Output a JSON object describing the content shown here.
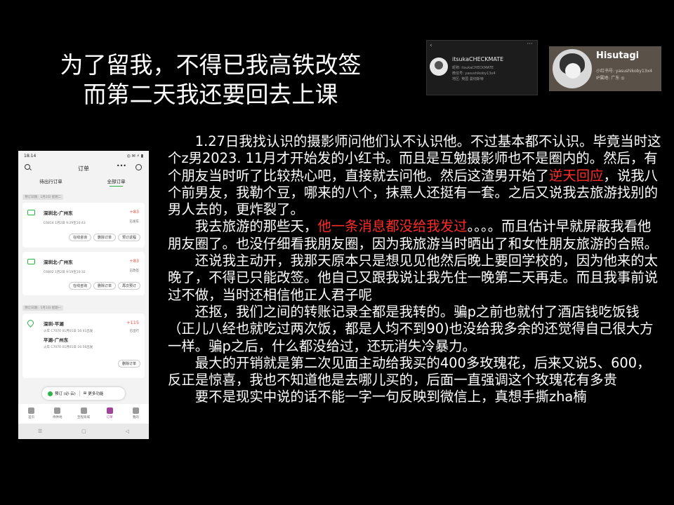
{
  "title": {
    "line1": "为了留我，不得已我高铁改签",
    "line2": "而第二天我还要回去上课"
  },
  "profile1": {
    "name": "itsukaCHECKMATE",
    "meta": [
      "昵称: itsukaCHECKMATE",
      "微信号: yasushikoby13x4",
      "地区: 英国 曼彻斯特"
    ]
  },
  "profile2": {
    "name": "Hisutagi",
    "meta": [
      "小红书号: yasushikoby13x4",
      "IP属地: 广东 ◎"
    ]
  },
  "phone": {
    "time": "18:14",
    "status_icons": "◎ ✉ ⚡ ▮",
    "header_title": "订单",
    "header_more": "•••",
    "tab_pending": "待出行订单",
    "tab_all": "全部订单",
    "sections": [
      "预订日期：1月2日 星期二",
      "预订日期：1月1日 星期一"
    ],
    "orders": [
      {
        "route": "深圳北-广州东",
        "price": "+83",
        "info": "C6814 1月2日 9:29至10:43",
        "state": "已发车",
        "buttons": [
          "在线咨询",
          "删除订单",
          "预订返程"
        ]
      },
      {
        "route": "深圳北-广州东",
        "price": "+83",
        "info": "C6802 1月2日 9:19至10:32",
        "state": "已改签",
        "buttons": [
          "在线咨询",
          "删除订单",
          "再次预订"
        ]
      },
      {
        "route": "深圳-平湖",
        "price": "+115",
        "info": "火车 C7070 01月01日 16:41出发",
        "route2": "平湖-广州东",
        "info2": "火车 C7070 01月01日 16:56出发",
        "state": "已出行",
        "buttons": [
          "删除订单"
        ]
      }
    ],
    "float_book": "预订 (必·云)",
    "float_more": "更多功能",
    "nav": [
      "首页",
      "待供地",
      "至程商城",
      "订单",
      "我的"
    ],
    "sysbar": [
      "☰",
      "▢",
      "◁"
    ]
  },
  "body": {
    "p1a": "1.27日我找认识的摄影师问他们认不认识他。不过基本都不认识。毕竟当时这个z男2023. 11月才开始发的小红书。而且是互勉摄影师也不是圈内的。然后，有个朋友当时听了比较热心吧，直接就去问他。然后这渣男开始了",
    "p1_red": "逆天回应",
    "p1b": "，说我八个前男友，我勒个豆，哪来的八个，抹黑人还挺有一套。之后又说我去旅游找别的男人去的，更炸裂了。",
    "p2a": "我去旅游的那些天，",
    "p2_red": "他一条消息都没给我发过",
    "p2b": "。。。。而且估计早就屏蔽我看他朋友圈了。也没仔细看我朋友圈，因为我旅游当时晒出了和女性朋友旅游的合照。",
    "p3": "还说我主动开，我那天原本只是想见见他然后晚上要回学校的，因为他来的太晚了，不得已只能改签。他自己又跟我说让我先住一晚第二天再走。而且我事前说过不做，当时还相信他正人君子呢",
    "p4": "还抠，我们之间的转账记录全都是我转的。骗p之前也就付了酒店钱吃饭钱（正儿八经也就吃过两次饭，都是人均不到90)也没给我多余的还觉得自己很大方一样。骗p之后，什么都没给过，还玩消失冷暴力。",
    "p5": "最大的开销就是第二次见面主动给我买的400多玫瑰花，后来又说5、600，反正是惊喜，我也不知道他是去哪儿买的，后面一直强调这个玫瑰花有多贵",
    "p6": "要不是现实中说的话不能一字一句反映到微信上，真想手撕zha楠"
  }
}
